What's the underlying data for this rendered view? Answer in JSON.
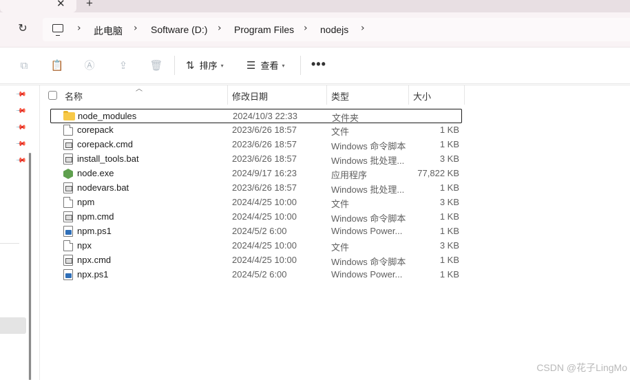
{
  "tabs": {
    "close_glyph": "✕",
    "new_glyph": "+"
  },
  "address_bar": {
    "separator": "›",
    "breadcrumbs": [
      "此电脑",
      "Software (D:)",
      "Program Files",
      "nodejs"
    ]
  },
  "toolbar": {
    "sort_label": "排序",
    "view_label": "查看",
    "more_label": "•••",
    "icons": [
      "copy-icon",
      "paste-icon",
      "rename-icon",
      "share-icon",
      "delete-icon",
      "sort-icon",
      "view-icon",
      "more-icon"
    ]
  },
  "columns": {
    "name": "名称",
    "date_modified": "修改日期",
    "type": "类型",
    "size": "大小"
  },
  "files": [
    {
      "name": "node_modules",
      "date": "2024/10/3 22:33",
      "type": "文件夹",
      "size": "",
      "icon": "folder-icon"
    },
    {
      "name": "corepack",
      "date": "2023/6/26 18:57",
      "type": "文件",
      "size": "1 KB",
      "icon": "file-icon"
    },
    {
      "name": "corepack.cmd",
      "date": "2023/6/26 18:57",
      "type": "Windows 命令脚本",
      "size": "1 KB",
      "icon": "cmd-file-icon"
    },
    {
      "name": "install_tools.bat",
      "date": "2023/6/26 18:57",
      "type": "Windows 批处理...",
      "size": "3 KB",
      "icon": "cmd-file-icon"
    },
    {
      "name": "node.exe",
      "date": "2024/9/17 16:23",
      "type": "应用程序",
      "size": "77,822 KB",
      "icon": "nodejs-icon"
    },
    {
      "name": "nodevars.bat",
      "date": "2023/6/26 18:57",
      "type": "Windows 批处理...",
      "size": "1 KB",
      "icon": "cmd-file-icon"
    },
    {
      "name": "npm",
      "date": "2024/4/25 10:00",
      "type": "文件",
      "size": "3 KB",
      "icon": "file-icon"
    },
    {
      "name": "npm.cmd",
      "date": "2024/4/25 10:00",
      "type": "Windows 命令脚本",
      "size": "1 KB",
      "icon": "cmd-file-icon"
    },
    {
      "name": "npm.ps1",
      "date": "2024/5/2 6:00",
      "type": "Windows Power...",
      "size": "1 KB",
      "icon": "powershell-file-icon"
    },
    {
      "name": "npx",
      "date": "2024/4/25 10:00",
      "type": "文件",
      "size": "3 KB",
      "icon": "file-icon"
    },
    {
      "name": "npx.cmd",
      "date": "2024/4/25 10:00",
      "type": "Windows 命令脚本",
      "size": "1 KB",
      "icon": "cmd-file-icon"
    },
    {
      "name": "npx.ps1",
      "date": "2024/5/2 6:00",
      "type": "Windows Power...",
      "size": "1 KB",
      "icon": "powershell-file-icon"
    }
  ],
  "watermark": "CSDN @花子LingMo"
}
